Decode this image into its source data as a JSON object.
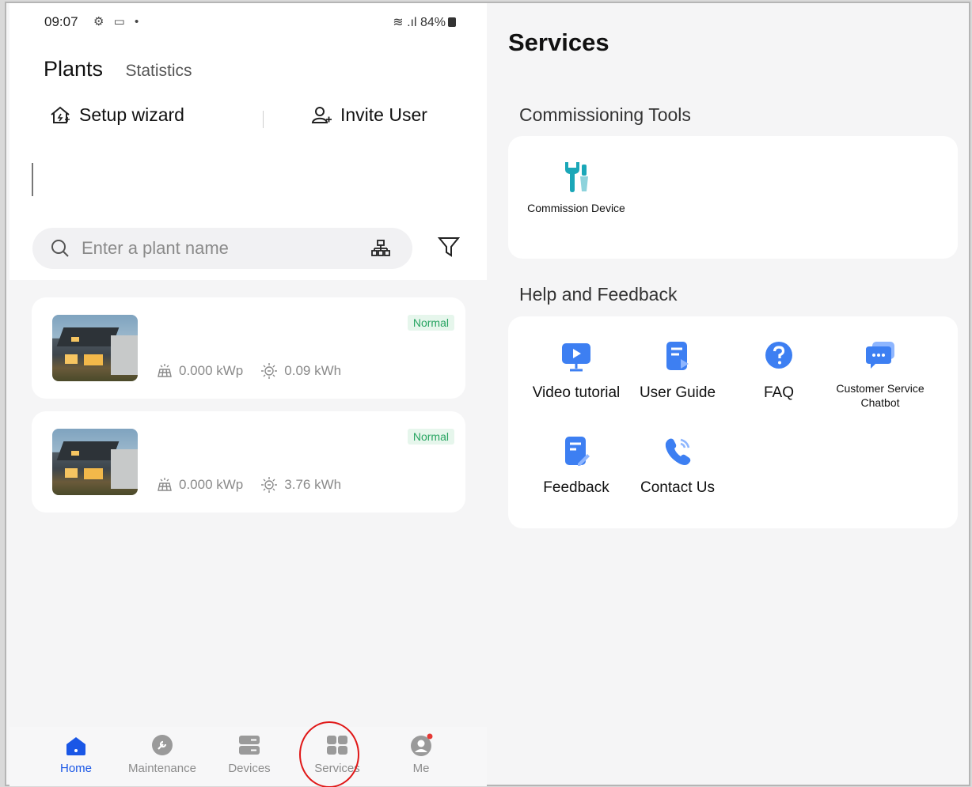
{
  "phone": {
    "status": {
      "time": "09:07",
      "right": "84%"
    },
    "tabs": {
      "plants": "Plants",
      "statistics": "Statistics"
    },
    "actions": {
      "setup": "Setup wizard",
      "invite": "Invite User"
    },
    "search": {
      "placeholder": "Enter a plant name"
    },
    "plants": [
      {
        "status": "Normal",
        "capacity": "0.000 kWp",
        "energy": "0.09 kWh"
      },
      {
        "status": "Normal",
        "capacity": "0.000 kWp",
        "energy": "3.76 kWh"
      }
    ],
    "nav": [
      {
        "label": "Home"
      },
      {
        "label": "Maintenance"
      },
      {
        "label": "Devices"
      },
      {
        "label": "Services"
      },
      {
        "label": "Me"
      }
    ]
  },
  "services": {
    "title": "Services",
    "commissioning": {
      "title": "Commissioning Tools",
      "items": [
        {
          "label": "Commission Device",
          "icon": "wrench-screwdriver-icon"
        }
      ]
    },
    "help": {
      "title": "Help and Feedback",
      "items": [
        {
          "label": "Video tutorial",
          "icon": "video-play-icon"
        },
        {
          "label": "User Guide",
          "icon": "document-icon"
        },
        {
          "label": "FAQ",
          "icon": "question-icon"
        },
        {
          "label": "Customer Service Chatbot",
          "icon": "chat-icon"
        },
        {
          "label": "Feedback",
          "icon": "feedback-icon"
        },
        {
          "label": "Contact Us",
          "icon": "phone-icon"
        }
      ]
    }
  },
  "colors": {
    "accent": "#1a57e6",
    "normal": "#27a461",
    "icon_blue": "#3d7ff2",
    "icon_teal": "#1aa7b8",
    "highlight": "#e01818"
  }
}
